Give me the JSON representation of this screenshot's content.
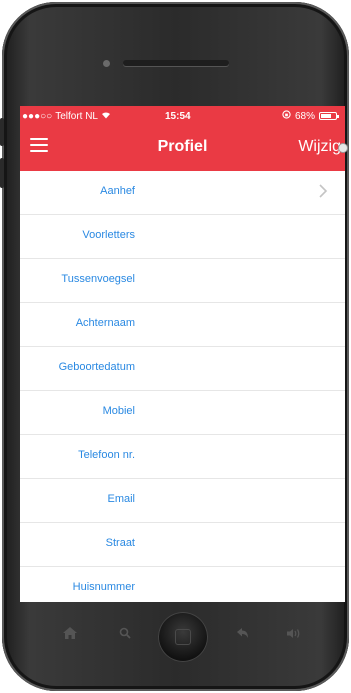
{
  "status_bar": {
    "signal": "●●●○○",
    "carrier": "Telfort NL",
    "time": "15:54",
    "battery_text": "68%",
    "battery_level": 0.68
  },
  "navbar": {
    "title": "Profiel",
    "edit_label": "Wijzig"
  },
  "profile_fields": [
    {
      "label": "Aanhef",
      "has_chevron": true
    },
    {
      "label": "Voorletters"
    },
    {
      "label": "Tussenvoegsel"
    },
    {
      "label": "Achternaam"
    },
    {
      "label": "Geboortedatum"
    },
    {
      "label": "Mobiel"
    },
    {
      "label": "Telefoon nr."
    },
    {
      "label": "Email"
    },
    {
      "label": "Straat"
    },
    {
      "label": "Huisnummer"
    }
  ],
  "colors": {
    "accent": "#ea3a44",
    "label": "#2a89e2"
  },
  "device_icons": [
    "home-icon",
    "search-icon",
    "back-icon",
    "volume-icon"
  ]
}
